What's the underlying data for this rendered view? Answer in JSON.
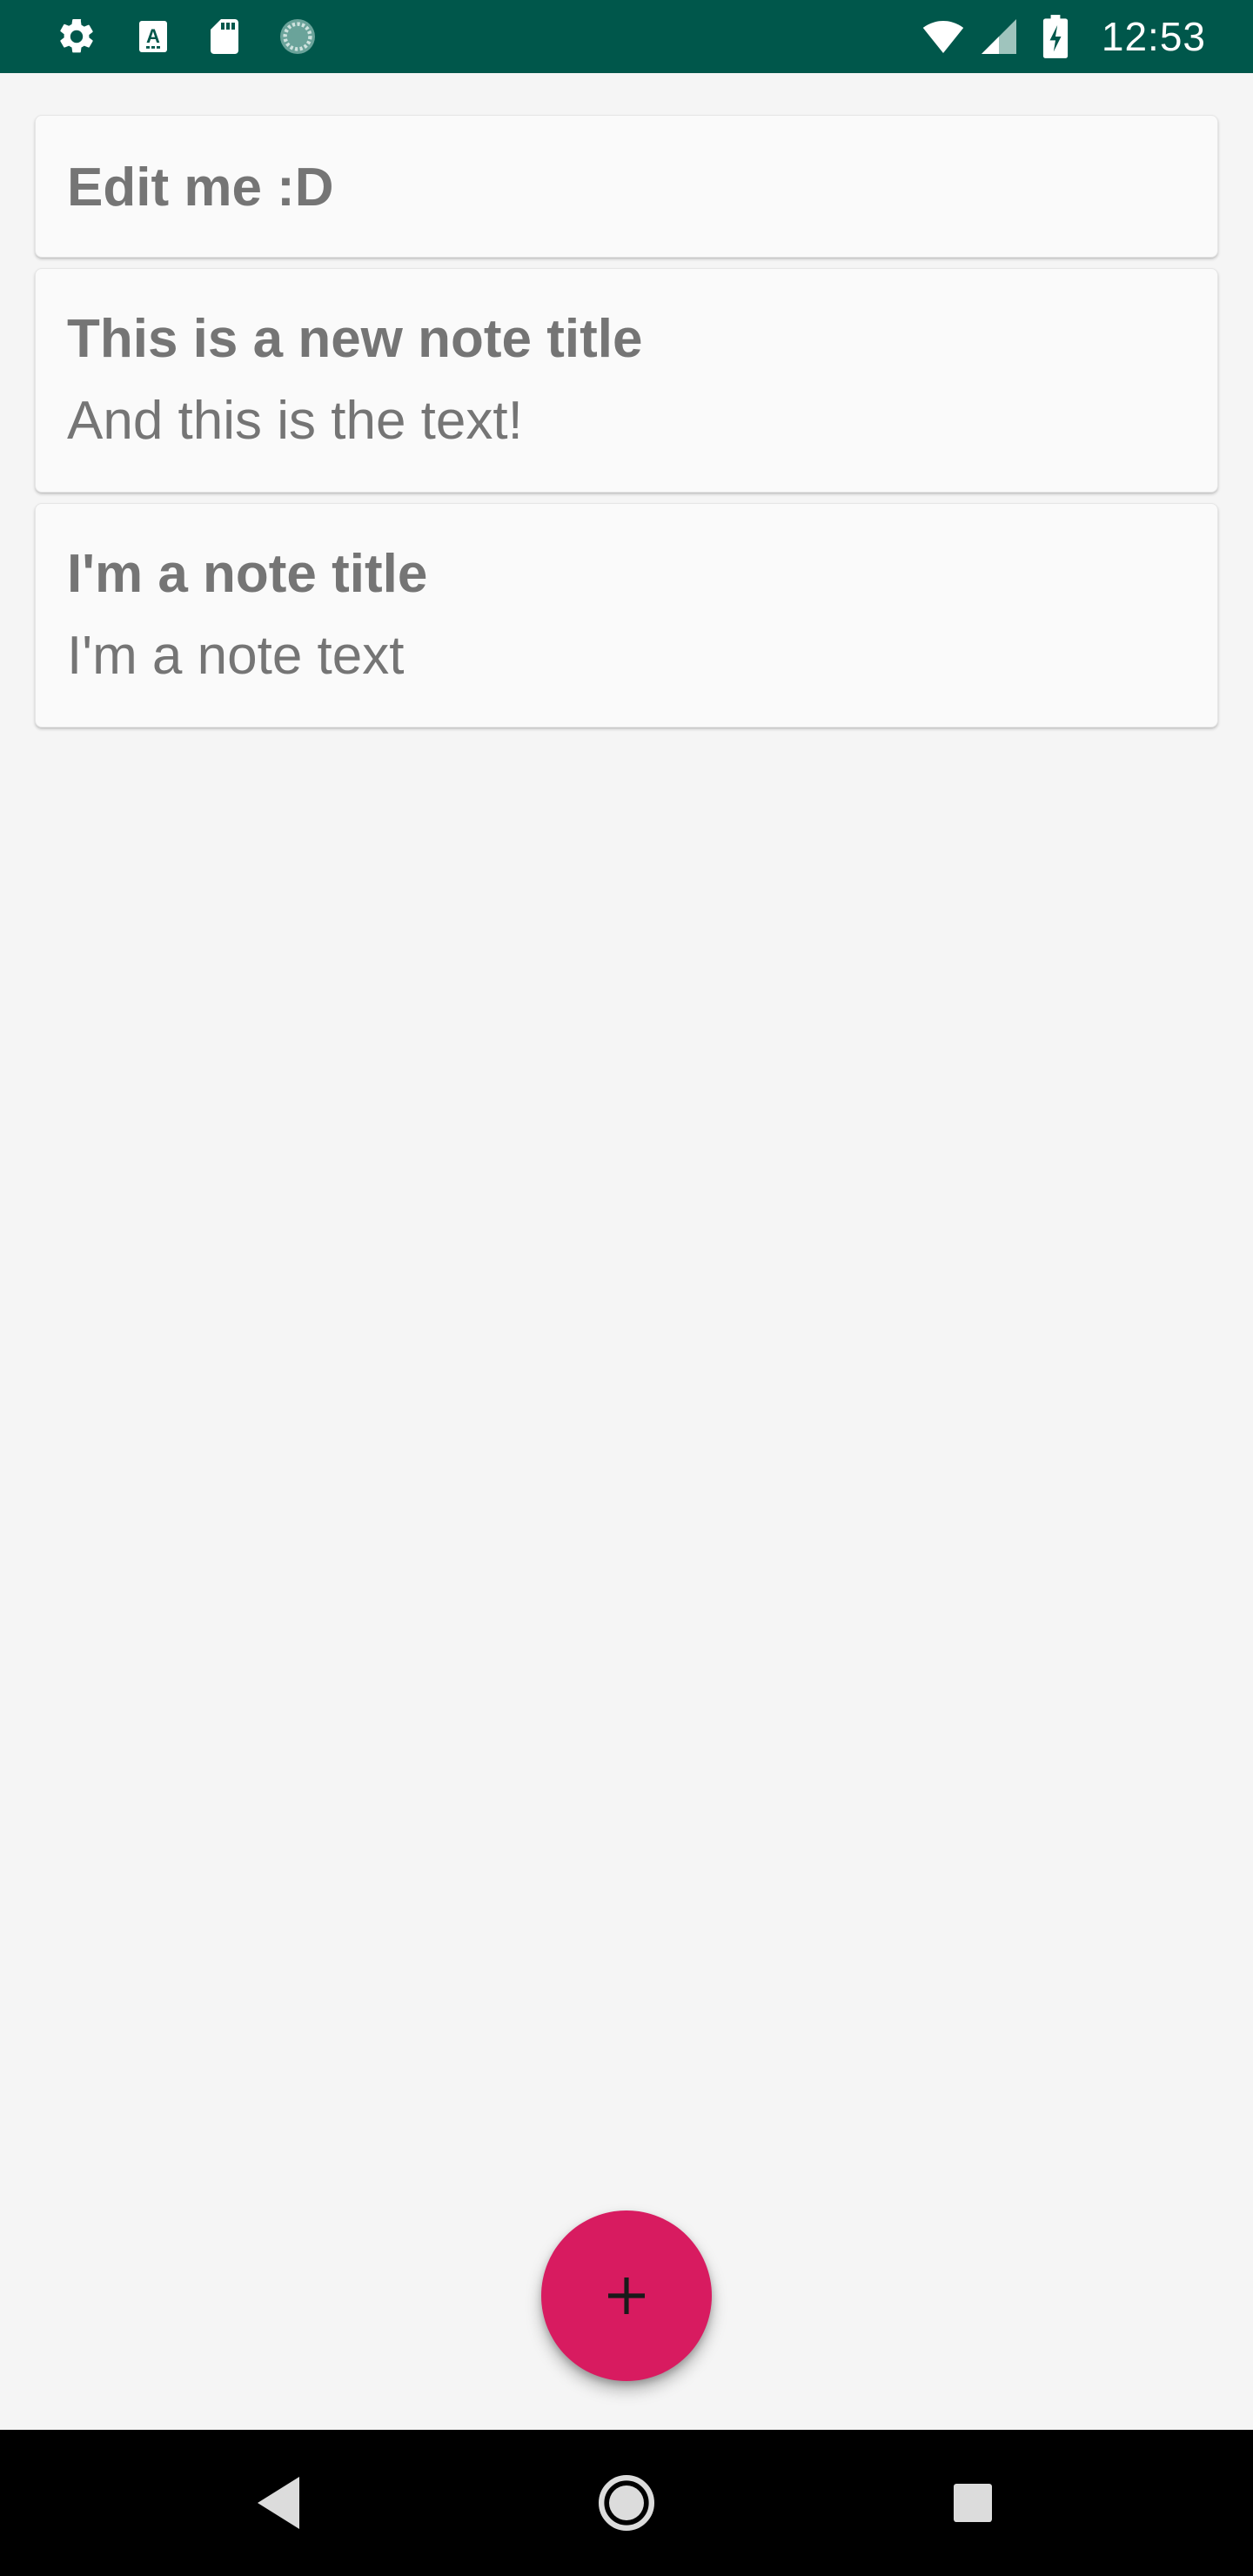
{
  "status_bar": {
    "time": "12:53",
    "background": "#00574b",
    "left_icons": [
      "settings-icon",
      "text-a-icon",
      "sd-card-icon",
      "sync-progress-icon"
    ],
    "right_icons": [
      "wifi-icon",
      "cell-signal-icon",
      "battery-charging-icon"
    ]
  },
  "notes": [
    {
      "title": "Edit me :D",
      "text": ""
    },
    {
      "title": "This is a new note title",
      "text": "And this is the text!"
    },
    {
      "title": "I'm a note title",
      "text": "I'm a note text"
    }
  ],
  "fab": {
    "icon": "plus-icon",
    "color": "#d81b60"
  },
  "nav_bar": {
    "buttons": [
      "back-icon",
      "home-icon",
      "recents-icon"
    ]
  }
}
